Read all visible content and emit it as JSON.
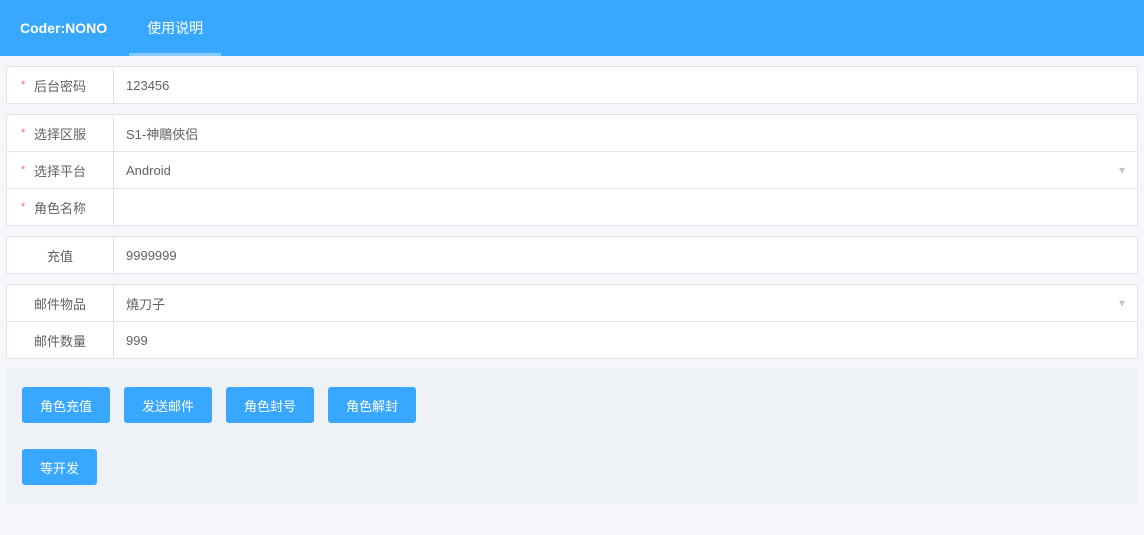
{
  "header": {
    "brand": "Coder:NONO",
    "tabs": [
      {
        "label": "使用说明",
        "active": true
      }
    ]
  },
  "form": {
    "backend_password": {
      "label": "后台密码",
      "value": "123456",
      "required": true
    },
    "server": {
      "label": "选择区服",
      "value": "S1-神鵰俠侣",
      "required": true
    },
    "platform": {
      "label": "选择平台",
      "value": "Android",
      "required": true
    },
    "character": {
      "label": "角色名称",
      "value": "",
      "required": true
    },
    "recharge": {
      "label": "充值",
      "value": "9999999",
      "required": false
    },
    "mail_item": {
      "label": "邮件物品",
      "value": "燒刀子",
      "required": false
    },
    "mail_qty": {
      "label": "邮件数量",
      "value": "999",
      "required": false
    }
  },
  "buttons": {
    "row1": [
      {
        "label": "角色充值",
        "name": "recharge-button"
      },
      {
        "label": "发送邮件",
        "name": "send-mail-button"
      },
      {
        "label": "角色封号",
        "name": "ban-button"
      },
      {
        "label": "角色解封",
        "name": "unban-button"
      }
    ],
    "row2": [
      {
        "label": "等开发",
        "name": "pending-dev-button"
      }
    ]
  }
}
